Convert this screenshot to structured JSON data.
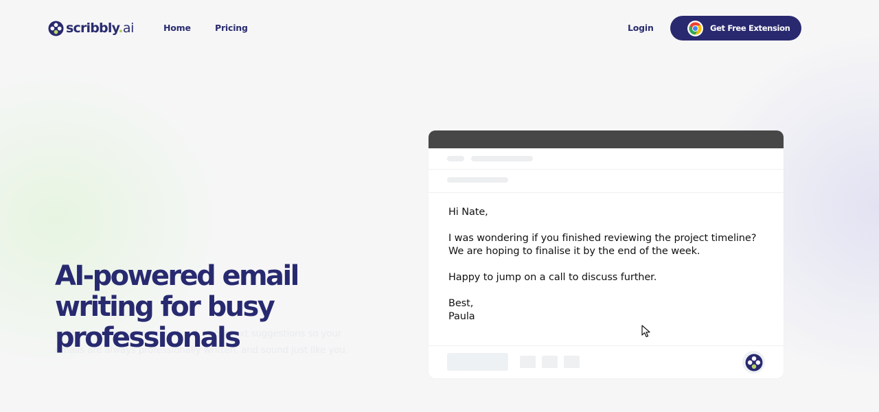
{
  "brand": {
    "name": "scribbly",
    "dot": ".",
    "suffix": "ai",
    "primary_color": "#29296f",
    "accent_color": "#a8c95a"
  },
  "nav": {
    "home": "Home",
    "pricing": "Pricing",
    "login": "Login",
    "cta_label": "Get Free Extension",
    "cta_icon": "chrome-icon"
  },
  "hero": {
    "title": "AI-powered email writing for busy professionals",
    "subtitle": "Scribbly gives you personalised, in-context suggestions so your emails are always professionally written, and sound just like you."
  },
  "email_preview": {
    "greeting": "Hi Nate,",
    "paragraph_1": "I was wondering if you finished reviewing the project timeline? We are hoping to finalise it by the end of the week.",
    "paragraph_2": "Happy to jump on a call to discuss further.",
    "signoff": "Best,",
    "signature": "Paula",
    "toolbar_bar_color": "#474747"
  }
}
